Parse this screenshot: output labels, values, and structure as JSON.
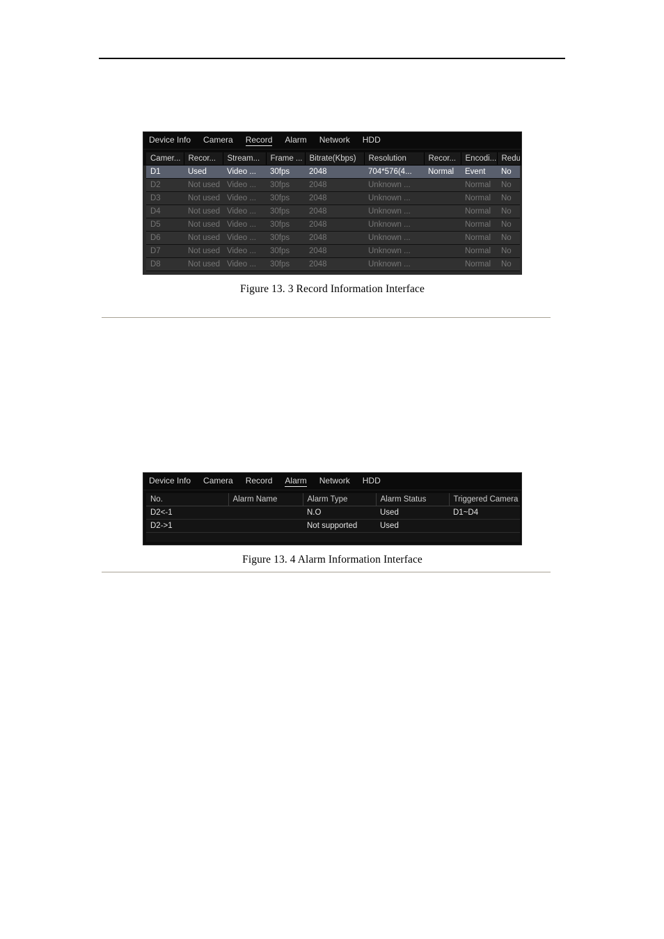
{
  "page": {
    "background": "#ffffff",
    "header_rule_color": "#000000",
    "section_rule_color": "#a8a295"
  },
  "figures": [
    {
      "id": "record-information",
      "caption": "Figure 13. 3  Record Information Interface",
      "panel": {
        "active_tab": "Record",
        "tabs": [
          "Device Info",
          "Camera",
          "Record",
          "Alarm",
          "Network",
          "HDD"
        ],
        "table": {
          "columns": [
            "Camer...",
            "Recor...",
            "Stream...",
            "Frame ...",
            "Bitrate(Kbps)",
            "Resolution",
            "Recor...",
            "Encodi...",
            "Redun..."
          ],
          "rows": [
            {
              "state": "active",
              "cells": [
                "D1",
                "Used",
                "Video ...",
                "30fps",
                "2048",
                "704*576(4...",
                "Normal",
                "Event",
                "No"
              ]
            },
            {
              "state": "dim",
              "cells": [
                "D2",
                "Not used",
                "Video ...",
                "30fps",
                "2048",
                "Unknown ...",
                "",
                "Normal",
                "No"
              ]
            },
            {
              "state": "dim",
              "cells": [
                "D3",
                "Not used",
                "Video ...",
                "30fps",
                "2048",
                "Unknown ...",
                "",
                "Normal",
                "No"
              ]
            },
            {
              "state": "dim",
              "cells": [
                "D4",
                "Not used",
                "Video ...",
                "30fps",
                "2048",
                "Unknown ...",
                "",
                "Normal",
                "No"
              ]
            },
            {
              "state": "dim",
              "cells": [
                "D5",
                "Not used",
                "Video ...",
                "30fps",
                "2048",
                "Unknown ...",
                "",
                "Normal",
                "No"
              ]
            },
            {
              "state": "dim",
              "cells": [
                "D6",
                "Not used",
                "Video ...",
                "30fps",
                "2048",
                "Unknown ...",
                "",
                "Normal",
                "No"
              ]
            },
            {
              "state": "dim",
              "cells": [
                "D7",
                "Not used",
                "Video ...",
                "30fps",
                "2048",
                "Unknown ...",
                "",
                "Normal",
                "No"
              ]
            },
            {
              "state": "dim",
              "cells": [
                "D8",
                "Not used",
                "Video ...",
                "30fps",
                "2048",
                "Unknown ...",
                "",
                "Normal",
                "No"
              ]
            }
          ]
        }
      }
    },
    {
      "id": "alarm-information",
      "caption": "Figure 13. 4 Alarm Information Interface",
      "panel": {
        "active_tab": "Alarm",
        "tabs": [
          "Device Info",
          "Camera",
          "Record",
          "Alarm",
          "Network",
          "HDD"
        ],
        "table": {
          "columns": [
            "No.",
            "Alarm Name",
            "Alarm Type",
            "Alarm Status",
            "Triggered Camera"
          ],
          "rows": [
            {
              "state": "normal",
              "cells": [
                "D2<-1",
                "",
                "N.O",
                "Used",
                "D1~D4"
              ]
            },
            {
              "state": "normal",
              "cells": [
                "D2->1",
                "",
                "Not supported",
                "Used",
                ""
              ]
            },
            {
              "state": "blank",
              "cells": [
                "",
                "",
                "",
                "",
                ""
              ]
            }
          ]
        }
      }
    }
  ],
  "colors": {
    "row_active_bg": "#595f6d",
    "row_dim_text": "#767676",
    "panel_bg": "#0c0c0c",
    "header_cell_bg": "#1a1a1a"
  }
}
